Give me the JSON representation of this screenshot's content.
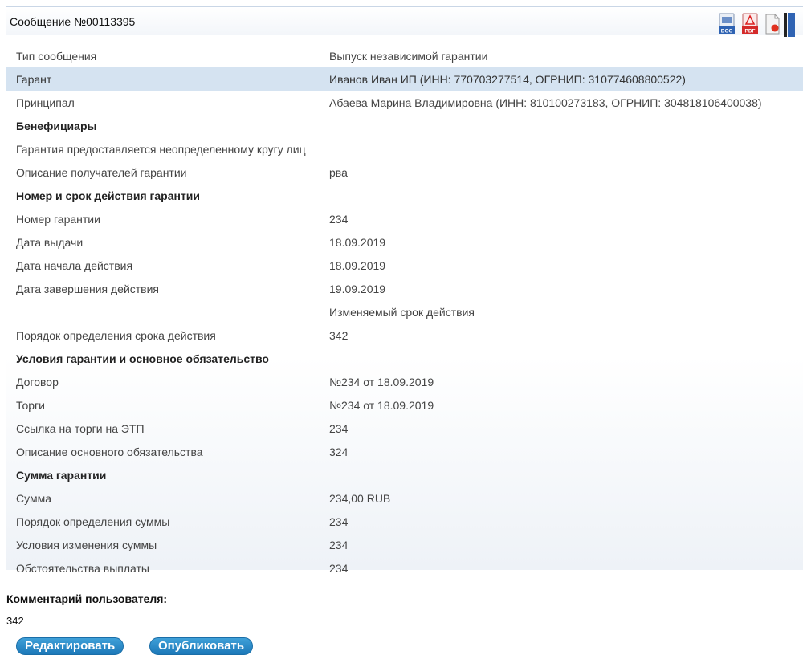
{
  "header": {
    "title": "Сообщение №00113395",
    "icons": [
      "doc-icon",
      "pdf-icon",
      "record-icon",
      "bookmark-icon"
    ],
    "icon_labels": {
      "doc": "DOC",
      "pdf": "PDF"
    }
  },
  "rows": [
    {
      "label": "Тип сообщения",
      "value": "Выпуск независимой гарантии"
    },
    {
      "label": "Гарант",
      "value": "Иванов Иван ИП (ИНН: 770703277514, ОГРНИП: 310774608800522)"
    },
    {
      "label": "Принципал",
      "value": "Абаева Марина Владимировна (ИНН: 810100273183, ОГРНИП: 304818106400038)"
    },
    {
      "label": "Бенефициары",
      "value": ""
    },
    {
      "label": "Гарантия предоставляется неопределенному кругу лиц",
      "value": ""
    },
    {
      "label": "Описание получателей гарантии",
      "value": "рва"
    },
    {
      "label": "Номер и срок действия гарантии",
      "value": ""
    },
    {
      "label": "Номер гарантии",
      "value": "234"
    },
    {
      "label": "Дата выдачи",
      "value": "18.09.2019"
    },
    {
      "label": "Дата начала действия",
      "value": "18.09.2019"
    },
    {
      "label": "Дата завершения действия",
      "value": "19.09.2019"
    },
    {
      "label": "",
      "value": "Изменяемый срок действия"
    },
    {
      "label": "Порядок определения срока действия",
      "value": "342"
    },
    {
      "label": "Условия гарантии и основное обязательство",
      "value": ""
    },
    {
      "label": "Договор",
      "value": "№234 от 18.09.2019"
    },
    {
      "label": "Торги",
      "value": "№234 от 18.09.2019"
    },
    {
      "label": "Ссылка на торги на ЭТП",
      "value": "234"
    },
    {
      "label": "Описание основного обязательства",
      "value": "324"
    },
    {
      "label": "Сумма гарантии",
      "value": ""
    },
    {
      "label": "Сумма",
      "value": "234,00 RUB"
    },
    {
      "label": "Порядок определения суммы",
      "value": "234"
    },
    {
      "label": "Условия изменения суммы",
      "value": "234"
    },
    {
      "label": "Обстоятельства выплаты",
      "value": "234"
    }
  ],
  "comment": {
    "label": "Комментарий пользователя:",
    "value": "342"
  },
  "buttons": {
    "edit": "Редактировать",
    "publish": "Опубликовать"
  },
  "colors": {
    "highlight_row": "#d5e3f1",
    "button": "#2a8bcb",
    "header_rule": "#2e4f8a"
  }
}
